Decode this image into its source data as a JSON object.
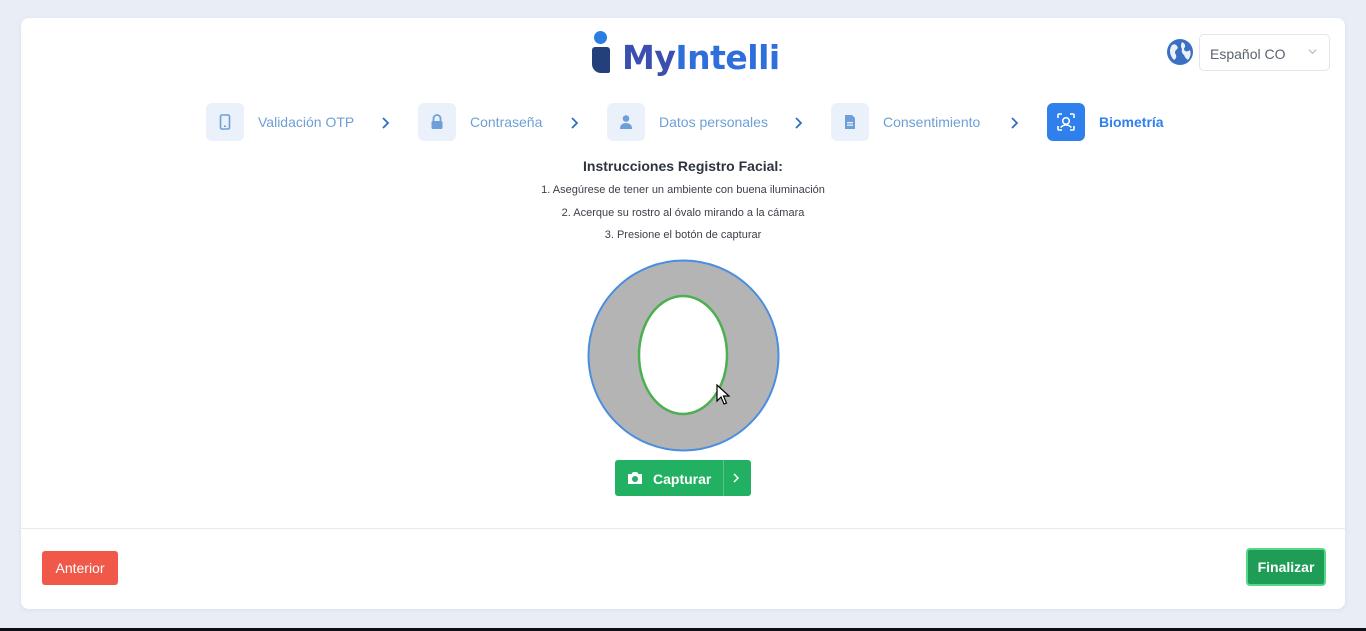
{
  "brand": {
    "logo_my": "My",
    "logo_intelli": "Intelli"
  },
  "language": {
    "selected": "Español CO",
    "icon": "globe-icon"
  },
  "stepper": {
    "steps": [
      {
        "label": "Validación OTP",
        "icon": "phone-icon",
        "active": false
      },
      {
        "label": "Contraseña",
        "icon": "lock-icon",
        "active": false
      },
      {
        "label": "Datos personales",
        "icon": "user-icon",
        "active": false
      },
      {
        "label": "Consentimiento",
        "icon": "document-icon",
        "active": false
      },
      {
        "label": "Biometría",
        "icon": "face-scan-icon",
        "active": true
      }
    ]
  },
  "instructions": {
    "title": "Instrucciones Registro Facial:",
    "lines": [
      "1. Asegúrese de tener un ambiente con buena iluminación",
      "2. Acerque su rostro al óvalo mirando a la cámara",
      "3. Presione el botón de capturar"
    ]
  },
  "capture": {
    "label": "Capturar",
    "icon": "camera-icon"
  },
  "footer": {
    "prev_label": "Anterior",
    "finish_label": "Finalizar"
  },
  "colors": {
    "primary": "#2f80ed",
    "success": "#22b163",
    "danger": "#f0594a",
    "oval_ring": "#b4b4b4",
    "oval_border": "#4caf50"
  }
}
